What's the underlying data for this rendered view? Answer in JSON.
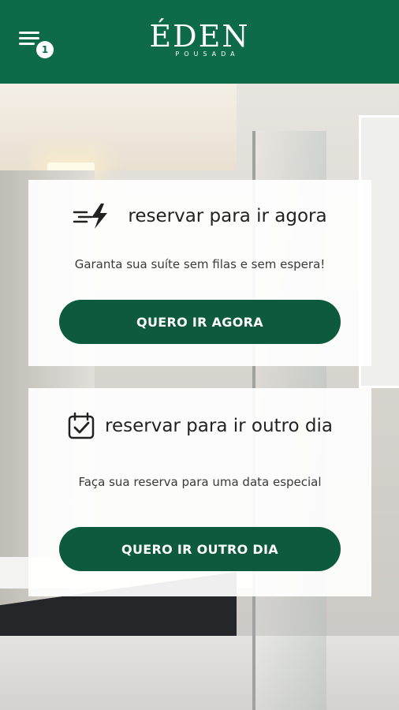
{
  "header": {
    "logo_main": "ÉDEN",
    "logo_sub": "POUSADA",
    "menu_badge": "1"
  },
  "cards": [
    {
      "icon": "lightning-speed-icon",
      "title": "reservar para ir agora",
      "description": "Garanta sua suíte sem filas e sem espera!",
      "button": "QUERO IR AGORA"
    },
    {
      "icon": "calendar-check-icon",
      "title": "reservar para ir outro dia",
      "description": "Faça sua reserva para uma data especial",
      "button": "QUERO IR OUTRO DIA"
    }
  ],
  "colors": {
    "brand_green": "#0d6b4a",
    "button_green": "#0d5a3e"
  }
}
